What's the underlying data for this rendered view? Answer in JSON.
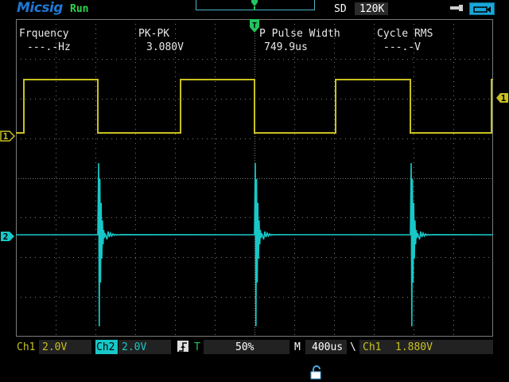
{
  "header": {
    "brand": "Micsig",
    "run_status": "Run",
    "acq_mode": "SD",
    "memory_depth": "120K"
  },
  "measurements": [
    {
      "name": "Frquency",
      "value": "---.-Hz"
    },
    {
      "name": "PK-PK",
      "value": "3.080V"
    },
    {
      "name": "P Pulse Width",
      "value": "749.9us"
    },
    {
      "name": "Cycle RMS",
      "value": "---.-V"
    }
  ],
  "markers": {
    "ch1": "1",
    "ch2": "2",
    "trigger_level": "1",
    "trigger_position": "T"
  },
  "colors": {
    "ch1": "#c8c020",
    "ch2": "#18c8c8",
    "grid": "#7a7a7a",
    "brand": "#1e78d6",
    "run": "#2fd64a",
    "trigger": "#22c55e"
  },
  "footer": {
    "ch1_label": "Ch1",
    "ch1_scale": "2.0V",
    "ch2_label": "Ch2",
    "ch2_scale": "2.0V",
    "trig_mode_icon": "trigger-edge-icon",
    "trig_letter": "T",
    "trig_position": "50%",
    "m_label": "M",
    "timebase": "400us",
    "trig_source": "Ch1",
    "trig_level": "1.880V"
  },
  "icons": {
    "usb": "usb-icon",
    "battery": "battery-icon",
    "lock": "lock-icon"
  }
}
